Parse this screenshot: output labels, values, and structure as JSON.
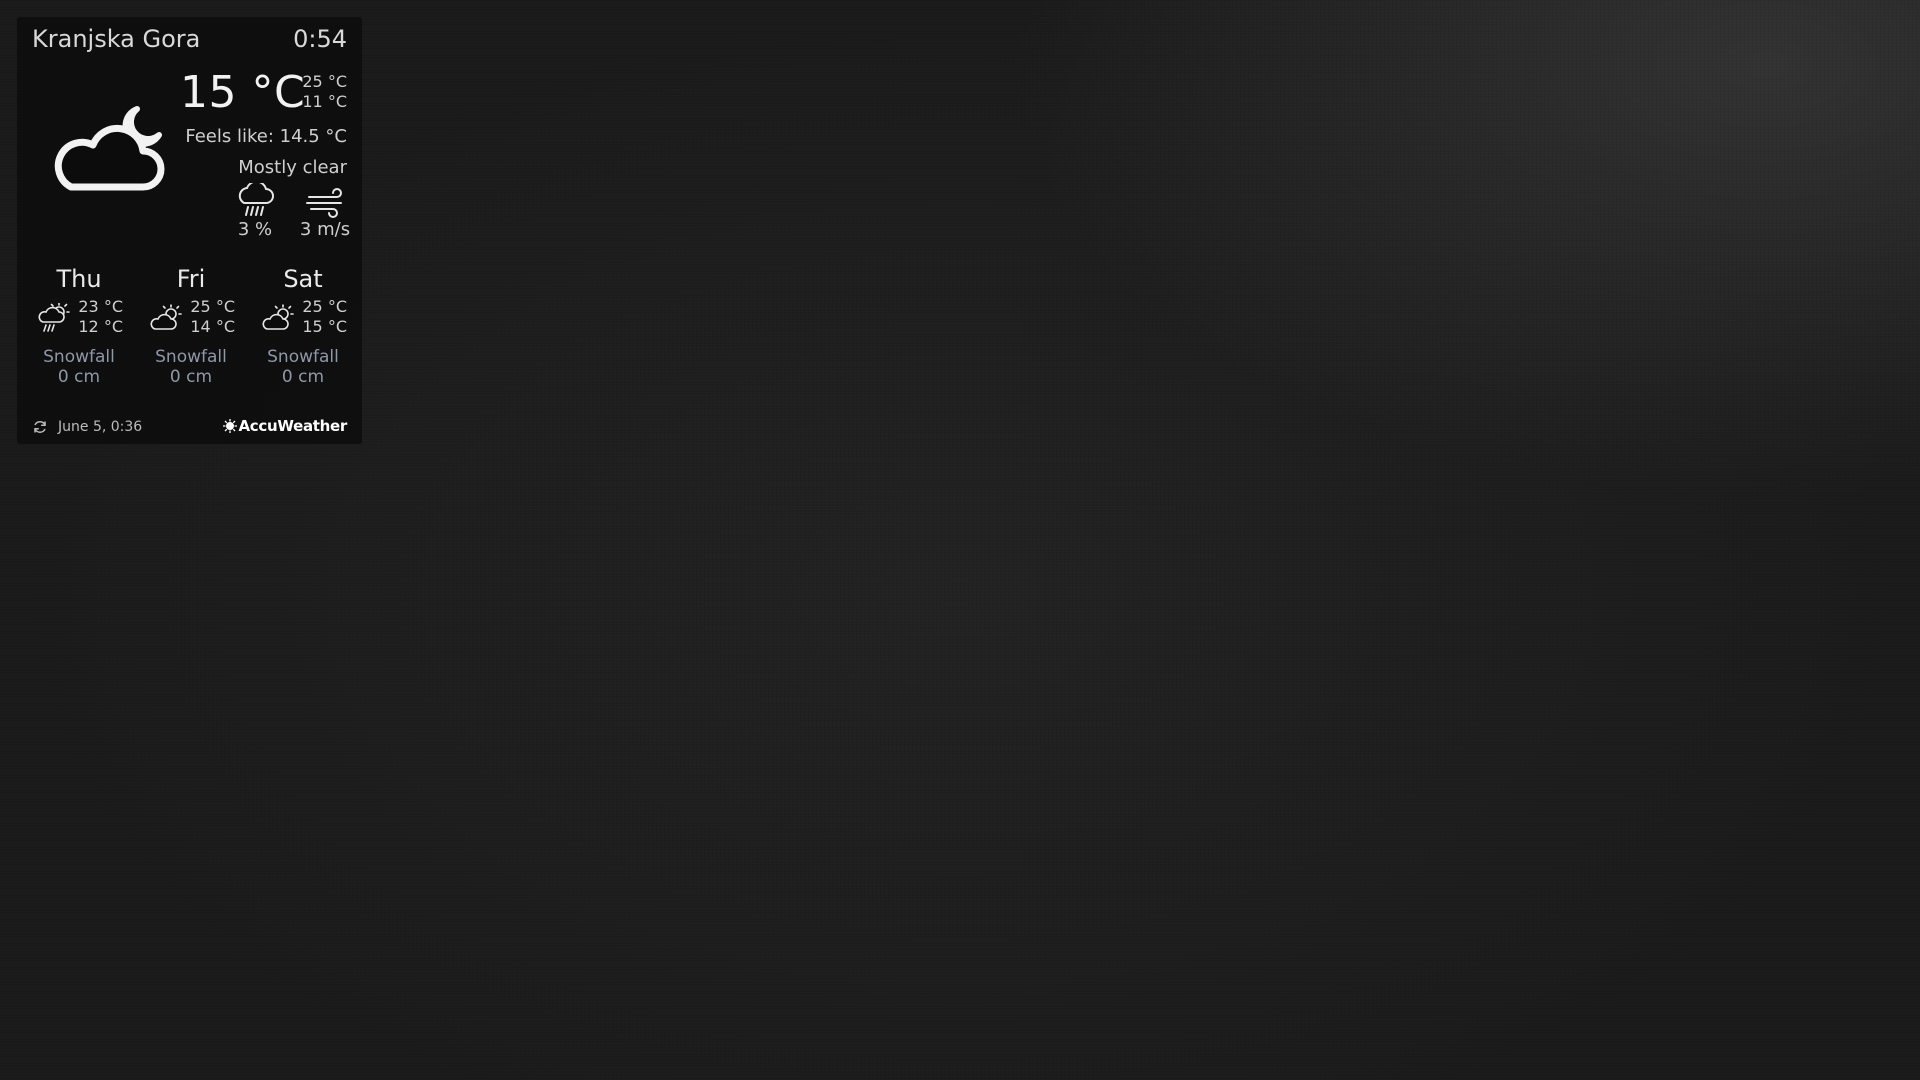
{
  "widget": {
    "location": "Kranjska Gora",
    "time": "0:54",
    "current": {
      "icon": "cloud-moon-icon",
      "temperature": "15 °C",
      "high": "25 °C",
      "low": "11 °C",
      "feels_like": "Feels like: 14.5 °C",
      "condition": "Mostly clear",
      "precipitation": "3 %",
      "precipitation_icon": "rain-cloud-icon",
      "wind": "3 m/s",
      "wind_icon": "wind-icon"
    },
    "forecast": [
      {
        "day": "Thu",
        "icon": "sun-rain-cloud-icon",
        "high": "23 °C",
        "low": "12 °C",
        "snow_label": "Snowfall",
        "snow_value": "0 cm"
      },
      {
        "day": "Fri",
        "icon": "sun-cloud-icon",
        "high": "25 °C",
        "low": "14 °C",
        "snow_label": "Snowfall",
        "snow_value": "0 cm"
      },
      {
        "day": "Sat",
        "icon": "sun-cloud-icon",
        "high": "25 °C",
        "low": "15 °C",
        "snow_label": "Snowfall",
        "snow_value": "0 cm"
      }
    ],
    "footer": {
      "updated": "June  5, 0:36",
      "brand": "AccuWeather"
    }
  },
  "colors": {
    "panel_background": "#0c0c0c",
    "text": "#e6e6e6",
    "snow_text": "#8e98a8"
  }
}
